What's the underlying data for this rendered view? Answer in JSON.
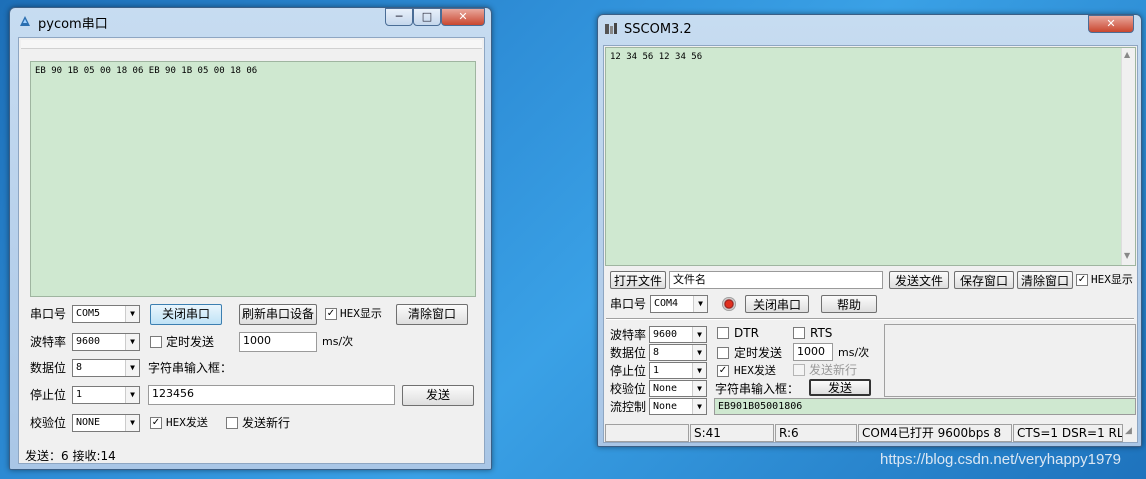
{
  "pycom": {
    "title": "pycom串口",
    "caption": {
      "minimize": "─",
      "maximize": "□",
      "close": "✕"
    },
    "receive_text": "EB 90 1B 05 00 18 06 EB 90 1B 05 00 18 06",
    "labels": {
      "port": "串口号",
      "baud": "波特率",
      "databits": "数据位",
      "stopbits": "停止位",
      "parity": "校验位"
    },
    "values": {
      "port": "COM5",
      "baud": "9600",
      "databits": "8",
      "stopbits": "1",
      "parity": "NONE"
    },
    "buttons": {
      "close_port": "关闭串口",
      "refresh": "刷新串口设备",
      "clear": "清除窗口",
      "send": "发送"
    },
    "hex_display": "HEX显示",
    "timed_send": "定时发送",
    "interval": "1000",
    "interval_unit": "ms/次",
    "string_input_label": "字符串输入框：",
    "input_value": "123456",
    "hex_send": "HEX发送",
    "send_newline": "发送新行",
    "status": "发送：6  接收:14"
  },
  "sscom": {
    "title": "SSCOM3.2",
    "caption": {
      "close": "✕"
    },
    "receive_text": "12 34 56 12 34 56",
    "open_file": "打开文件",
    "filename": "文件名",
    "send_file": "发送文件",
    "save_window": "保存窗口",
    "clear_window": "清除窗口",
    "hex_display": "HEX显示",
    "port_label": "串口号",
    "port_value": "COM4",
    "close_port": "关闭串口",
    "help": "帮助",
    "labels": {
      "baud": "波特率",
      "databits": "数据位",
      "stopbits": "停止位",
      "parity": "校验位",
      "flow": "流控制"
    },
    "values": {
      "baud": "9600",
      "databits": "8",
      "stopbits": "1",
      "parity": "None",
      "flow": "None"
    },
    "dtr": "DTR",
    "rts": "RTS",
    "timed_send": "定时发送",
    "interval": "1000",
    "interval_unit": "ms/次",
    "hex_send": "HEX发送",
    "send_newline": "发送新行",
    "string_input_label": "字符串输入框：",
    "send": "发送",
    "input_value": "EB901B05001806",
    "status": {
      "s": "S:41",
      "r": "R:6",
      "port": "COM4已打开  9600bps  8",
      "lines": "CTS=1 DSR=1 RL"
    }
  },
  "watermark": "https://blog.csdn.net/veryhappy1979"
}
